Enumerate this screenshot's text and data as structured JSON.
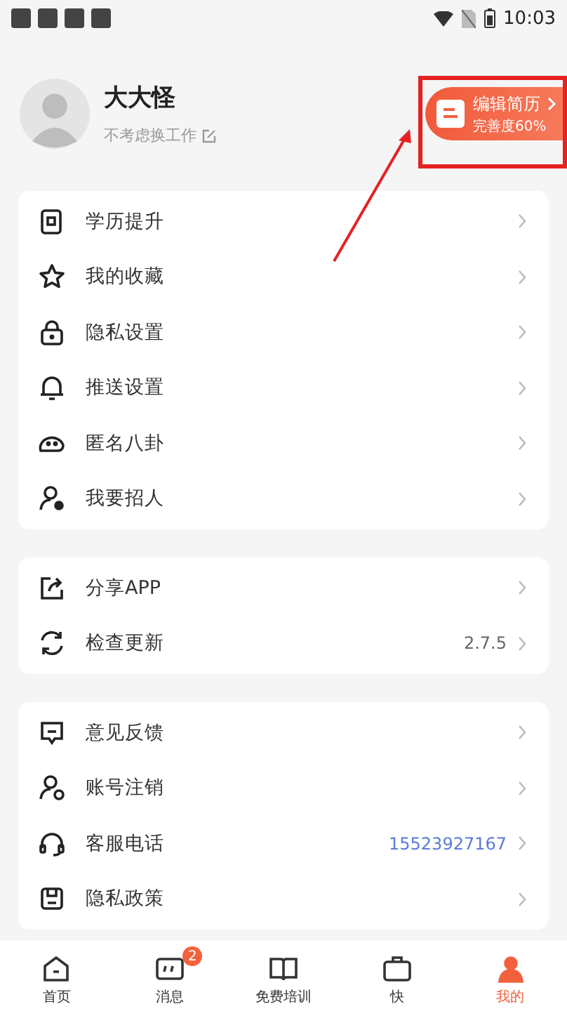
{
  "status_bar": {
    "time": "10:03"
  },
  "profile": {
    "name": "大大怪",
    "status": "不考虑换工作",
    "resume_button": {
      "label": "编辑简历",
      "completion": "完善度60%"
    }
  },
  "menu_groups": [
    {
      "items": [
        {
          "label": "学历提升"
        },
        {
          "label": "我的收藏"
        },
        {
          "label": "隐私设置"
        },
        {
          "label": "推送设置"
        },
        {
          "label": "匿名八卦"
        },
        {
          "label": "我要招人"
        }
      ]
    },
    {
      "items": [
        {
          "label": "分享APP"
        },
        {
          "label": "检查更新",
          "value": "2.7.5",
          "kind": "version"
        }
      ]
    },
    {
      "items": [
        {
          "label": "意见反馈"
        },
        {
          "label": "账号注销"
        },
        {
          "label": "客服电话",
          "value": "15523927167",
          "kind": "phone"
        },
        {
          "label": "隐私政策"
        }
      ]
    }
  ],
  "tab_bar": [
    {
      "label": "首页",
      "selected": false
    },
    {
      "label": "消息",
      "selected": false,
      "badge": "2"
    },
    {
      "label": "免费培训",
      "selected": false
    },
    {
      "label": "快",
      "selected": false
    },
    {
      "label": "我的",
      "selected": true
    }
  ]
}
